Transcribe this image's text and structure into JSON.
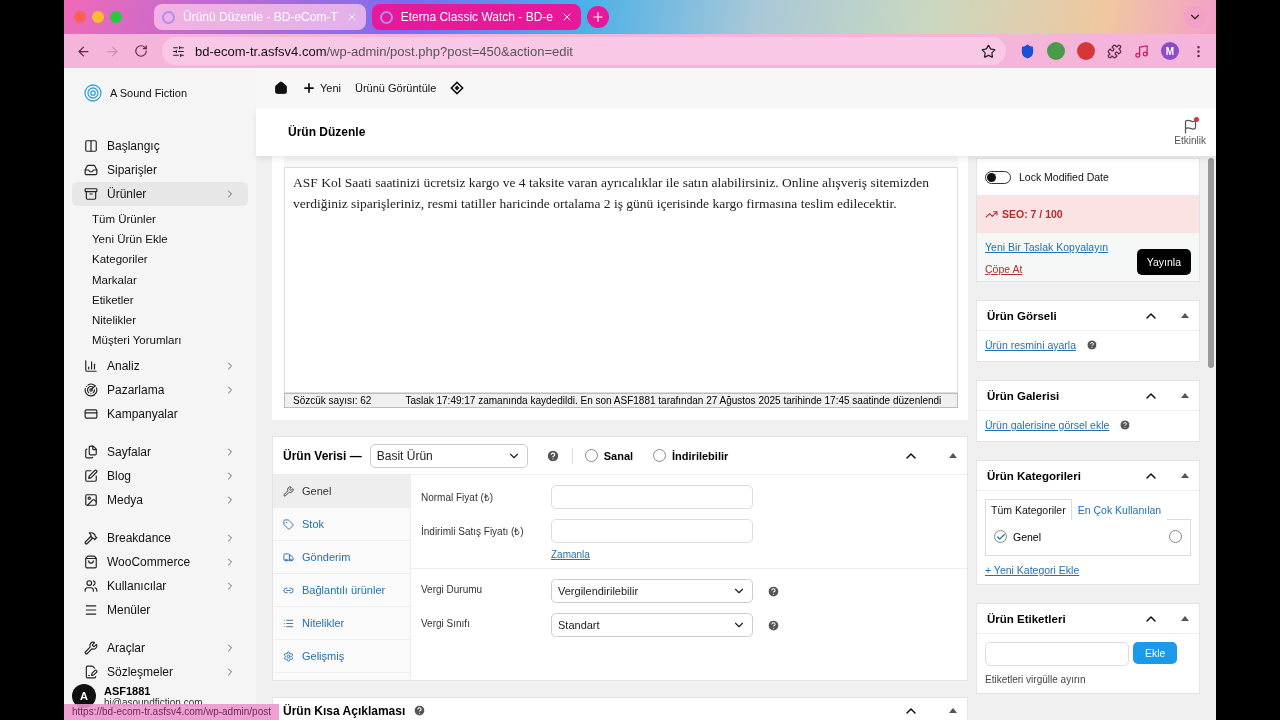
{
  "browser": {
    "tabs": [
      {
        "title": "Ürünü Düzenle - BD-eCom-T",
        "selected": true
      },
      {
        "title": "Eterna Classic Watch - BD-e",
        "selected": false
      }
    ],
    "url_host": "bd-ecom-tr.asfsv4.com",
    "url_path": "/wp-admin/post.php?post=450&action=edit",
    "profile": "M"
  },
  "sidebar": {
    "brand": "A Sound Fiction",
    "groups": [
      [
        {
          "label": "Başlangıç",
          "arrow": false,
          "selected": false
        },
        {
          "label": "Siparişler",
          "arrow": false,
          "selected": false
        },
        {
          "label": "Ürünler",
          "arrow": true,
          "selected": true,
          "children": [
            {
              "label": "Tüm Ürünler"
            },
            {
              "label": "Yeni Ürün Ekle"
            },
            {
              "label": "Kategoriler"
            },
            {
              "label": "Markalar"
            },
            {
              "label": "Etiketler"
            },
            {
              "label": "Nitelikler"
            },
            {
              "label": "Müşteri Yorumları"
            }
          ]
        },
        {
          "label": "Analiz",
          "arrow": true,
          "selected": false
        },
        {
          "label": "Pazarlama",
          "arrow": true,
          "selected": false
        },
        {
          "label": "Kampanyalar",
          "arrow": false,
          "selected": false
        }
      ],
      [
        {
          "label": "Sayfalar",
          "arrow": true,
          "selected": false
        },
        {
          "label": "Blog",
          "arrow": true,
          "selected": false
        },
        {
          "label": "Medya",
          "arrow": true,
          "selected": false
        }
      ],
      [
        {
          "label": "Breakdance",
          "arrow": true,
          "selected": false
        },
        {
          "label": "WooCommerce",
          "arrow": true,
          "selected": false
        },
        {
          "label": "Kullanıcılar",
          "arrow": true,
          "selected": false
        },
        {
          "label": "Menüler",
          "arrow": false,
          "selected": false
        }
      ],
      [
        {
          "label": "Araçlar",
          "arrow": true,
          "selected": false
        },
        {
          "label": "Sözleşmeler",
          "arrow": true,
          "selected": false
        }
      ]
    ],
    "user": {
      "avatar": "A",
      "name": "ASF1881",
      "email": "hi@asoundfiction.com"
    }
  },
  "status_link": "https://bd-ecom-tr.asfsv4.com/wp-admin/post",
  "toolbar": {
    "new": "Yeni",
    "view": "Ürünü Görüntüle"
  },
  "header": {
    "title": "Ürün Düzenle",
    "activity": "Etkinlik"
  },
  "editor": {
    "content": "ASF Kol Saati saatinizi ücretsiz kargo ve 4 taksite varan ayrıcalıklar ile satın alabilirsiniz. Online alışveriş sitemizden verdiğiniz siparişleriniz, resmi tatiller haricinde ortalama 2 iş günü içerisinde kargo firmasına teslim edilecektir.",
    "word_count": "Sözcük sayısı: 62",
    "save_status": "Taslak 17:49:17 zamanında kaydedildi. En son ASF1881 tarafından 27 Ağustos 2025 tarihinde 17:45 saatinde düzenlendi"
  },
  "product_data": {
    "title": "Ürün Verisi —",
    "type": "Basit Ürün",
    "options": [
      {
        "label": "Sanal",
        "checked": false
      },
      {
        "label": "İndirilebilir",
        "checked": false
      }
    ],
    "tabs": [
      {
        "label": "Genel",
        "selected": true
      },
      {
        "label": "Stok",
        "selected": false
      },
      {
        "label": "Gönderim",
        "selected": false
      },
      {
        "label": "Bağlantılı ürünler",
        "selected": false
      },
      {
        "label": "Nitelikler",
        "selected": false
      },
      {
        "label": "Gelişmiş",
        "selected": false
      }
    ],
    "sections": [
      [
        {
          "label": "Normal Fiyat (₺)",
          "kind": "input"
        },
        {
          "label": "İndirimli Satış Fiyatı (₺)",
          "kind": "input",
          "link": "Zamanla"
        }
      ],
      [
        {
          "label": "Vergi Durumu",
          "kind": "select",
          "value": "Vergilendirilebilir"
        },
        {
          "label": "Vergi Sınıfı",
          "kind": "select",
          "value": "Standart"
        }
      ]
    ]
  },
  "short_description": {
    "title": "Ürün Kısa Açıklaması"
  },
  "publish": {
    "lock": {
      "label": "Lock Modified Date",
      "on": false
    },
    "seo": "SEO: 7 / 100",
    "copy_link": "Yeni Bir Taslak Kopyalayın",
    "trash_link": "Çöpe At",
    "button": "Yayınla"
  },
  "image_box": {
    "title": "Ürün Görseli",
    "link": "Ürün resmini ayarla"
  },
  "gallery_box": {
    "title": "Ürün Galerisi",
    "link": "Ürün galerisine görsel ekle"
  },
  "categories_box": {
    "title": "Ürün Kategorileri",
    "tabs": [
      {
        "label": "Tüm Kategoriler",
        "selected": true
      },
      {
        "label": "En Çok Kullanılan",
        "selected": false
      }
    ],
    "items": [
      {
        "label": "Genel",
        "checked": true,
        "primary": false
      }
    ],
    "add_link": "+ Yeni Kategori Ekle"
  },
  "tags_box": {
    "title": "Ürün Etiketleri",
    "button": "Ekle",
    "hint": "Etiketleri virgülle ayırın"
  }
}
